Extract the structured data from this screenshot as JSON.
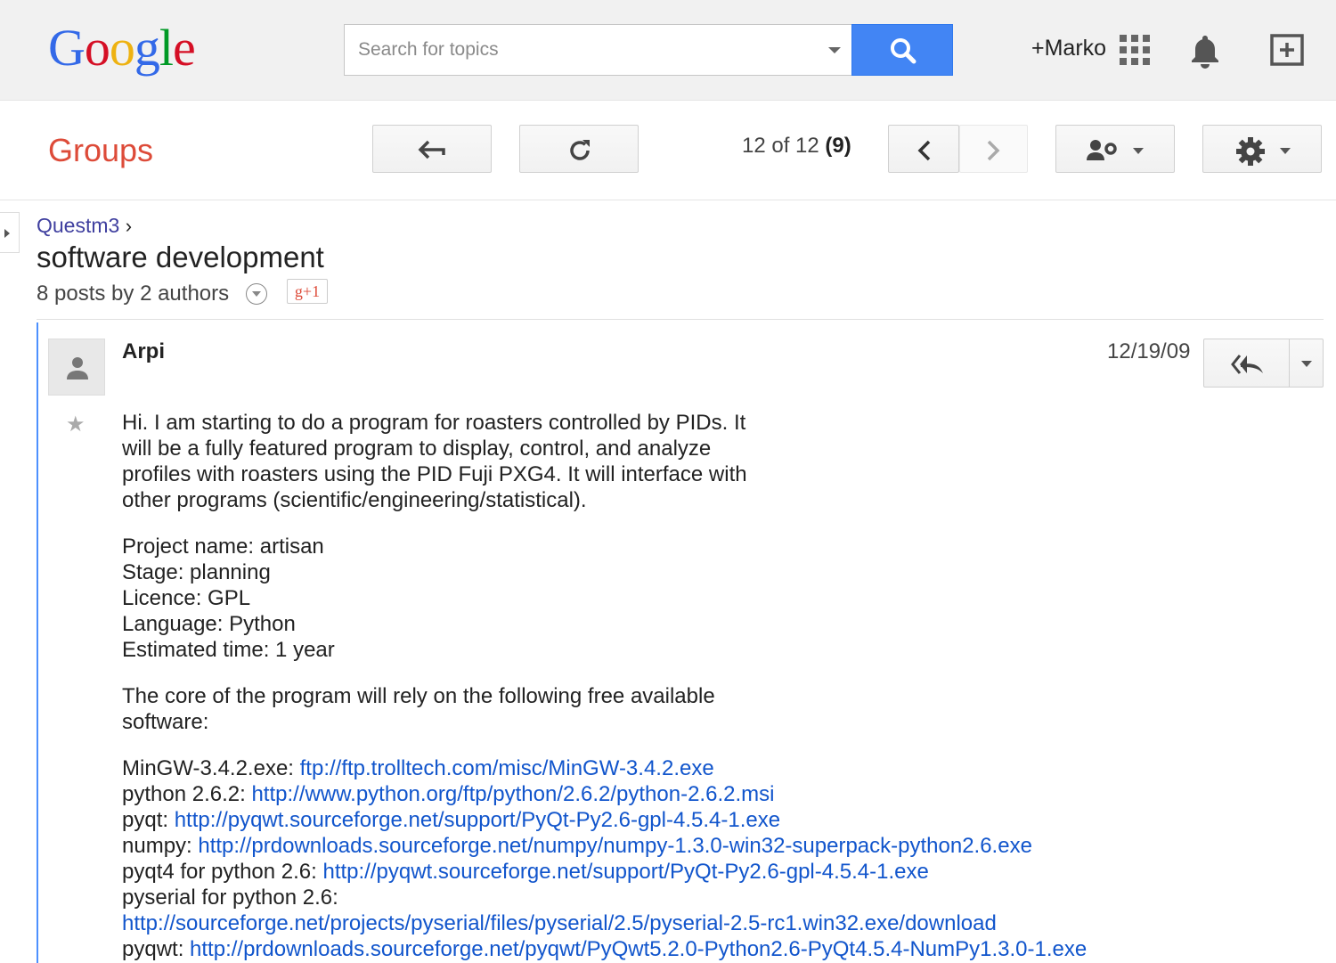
{
  "header": {
    "logo": [
      "G",
      "o",
      "o",
      "g",
      "l",
      "e"
    ],
    "search_placeholder": "Search for topics",
    "user": "+Marko"
  },
  "toolbar": {
    "app_title": "Groups",
    "counter": "12 of 12",
    "counter_unread": "(9)"
  },
  "topic": {
    "breadcrumb": "Questm3",
    "breadcrumb_sep": "›",
    "title": "software development",
    "meta": "8 posts by 2 authors",
    "plusone": "g+1"
  },
  "post": {
    "author": "Arpi",
    "date": "12/19/09",
    "intro": [
      "Hi. I am starting to do a program for roasters controlled by PIDs. It",
      "will be a fully featured program to display, control, and analyze",
      "profiles with roasters using the PID Fuji PXG4. It will interface with",
      "other programs (scientific/engineering/statistical)."
    ],
    "details": [
      "Project name: artisan",
      "Stage: planning",
      "Licence: GPL",
      "Language: Python",
      "Estimated time: 1 year"
    ],
    "core": [
      "The core of the program will rely on the following free available",
      "software:"
    ],
    "links": [
      {
        "label": "MinGW-3.4.2.exe: ",
        "url": "ftp://ftp.trolltech.com/misc/MinGW-3.4.2.exe"
      },
      {
        "label": "python 2.6.2: ",
        "url": "http://www.python.org/ftp/python/2.6.2/python-2.6.2.msi"
      },
      {
        "label": "pyqt: ",
        "url": "http://pyqwt.sourceforge.net/support/PyQt-Py2.6-gpl-4.5.4-1.exe"
      },
      {
        "label": "numpy: ",
        "url": "http://prdownloads.sourceforge.net/numpy/numpy-1.3.0-win32-superpack-python2.6.exe"
      },
      {
        "label": "pyqt4 for python 2.6: ",
        "url": "http://pyqwt.sourceforge.net/support/PyQt-Py2.6-gpl-4.5.4-1.exe"
      },
      {
        "label": "pyserial for python 2.6:",
        "url": ""
      },
      {
        "label": "",
        "url": "http://sourceforge.net/projects/pyserial/files/pyserial/2.5/pyserial-2.5-rc1.win32.exe/download"
      },
      {
        "label": "pyqwt: ",
        "url": "http://prdownloads.sourceforge.net/pyqwt/PyQwt5.2.0-Python2.6-PyQt4.5.4-NumPy1.3.0-1.exe"
      }
    ]
  },
  "colors": {
    "accent_blue": "#4285f4",
    "groups_red": "#dd4b39",
    "link_blue": "#1155cc",
    "post_bar": "#4d90fe"
  },
  "icons": [
    "search-icon",
    "apps-icon",
    "bell-icon",
    "share-box-icon",
    "back-arrow-icon",
    "refresh-icon",
    "chevron-left-icon",
    "chevron-right-icon",
    "people-settings-icon",
    "gear-icon",
    "person-icon",
    "reply-all-icon",
    "chevron-down-icon",
    "star-icon"
  ]
}
